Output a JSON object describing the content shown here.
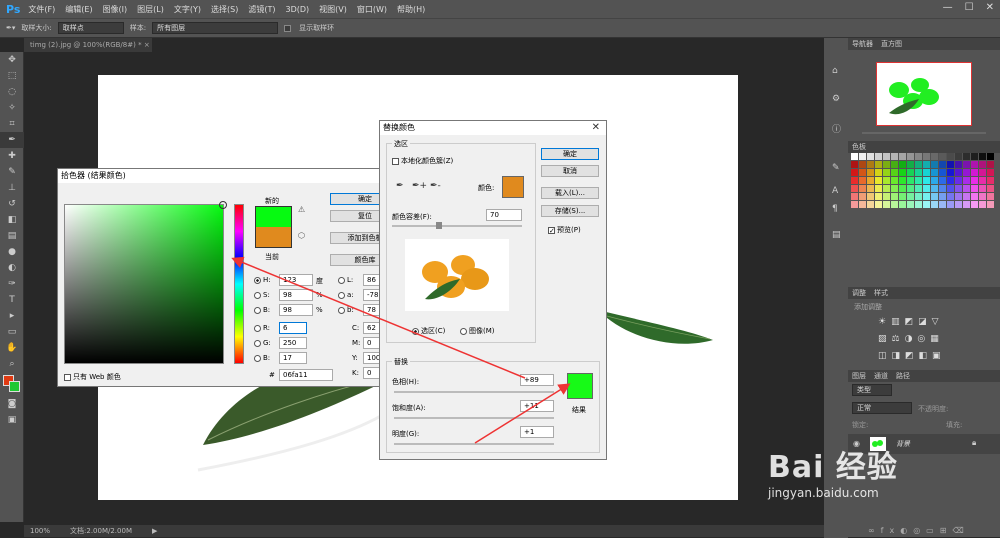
{
  "app": {
    "logo": "Ps"
  },
  "menu": [
    "文件(F)",
    "编辑(E)",
    "图像(I)",
    "图层(L)",
    "文字(Y)",
    "选择(S)",
    "滤镜(T)",
    "3D(D)",
    "视图(V)",
    "窗口(W)",
    "帮助(H)"
  ],
  "options": {
    "sample_size_label": "取样大小:",
    "sample_size_value": "取样点",
    "sample_label": "样本:",
    "sample_value": "所有图层",
    "show_ring": "显示取样环"
  },
  "document": {
    "tab_title": "timg (2).jpg @ 100%(RGB/8#) *",
    "zoom": "100%",
    "doc_info": "文档:2.00M/2.00M"
  },
  "colors": {
    "new": "#06fa11",
    "current": "#e08a1e",
    "fg": "#e03a12",
    "bg": "#1ec832",
    "result": "#17fa17",
    "orange_sample": "#e08a1e"
  },
  "picker": {
    "title": "拾色器 (结果颜色)",
    "new_label": "新的",
    "current_label": "当前",
    "ok": "确定",
    "reset": "复位",
    "add_swatch": "添加到色板",
    "color_lib": "颜色库",
    "H": "123",
    "H_unit": "度",
    "S": "98",
    "S_unit": "%",
    "Bv": "98",
    "B_unit": "%",
    "R": "6",
    "G": "250",
    "B": "17",
    "L": "86",
    "a": "-78",
    "b": "78",
    "C": "62",
    "M": "0",
    "Y": "100",
    "K": "0",
    "pct": "%",
    "hex": "06fa11",
    "hex_label": "#",
    "web_only": "只有 Web 颜色"
  },
  "replace": {
    "title": "替换颜色",
    "sel_group": "选区",
    "localized": "本地化颜色簇(Z)",
    "color_label": "颜色:",
    "fuzz_label": "颜色容差(F):",
    "fuzz": "70",
    "sel_radio": "选区(C)",
    "img_radio": "图像(M)",
    "ok": "确定",
    "cancel": "取消",
    "load": "载入(L)...",
    "save": "存储(S)...",
    "preview": "预览(P)",
    "rep_group": "替换",
    "hue_label": "色相(H):",
    "hue": "+89",
    "sat_label": "饱和度(A):",
    "sat": "+11",
    "light_label": "明度(G):",
    "light": "+1",
    "result_label": "结果"
  },
  "panels": {
    "nav_tabs": [
      "导航器",
      "直方图"
    ],
    "swatch_tabs": [
      "色板"
    ],
    "adj_tabs": [
      "调整",
      "样式"
    ],
    "adj_hint": "添加调整",
    "layer_tabs": [
      "图层",
      "通道",
      "路径"
    ],
    "kind": "类型",
    "blend": "正常",
    "opacity_label": "不透明度:",
    "lock_label": "锁定:",
    "fill_label": "填充:",
    "layer_name": "背景"
  },
  "watermark": {
    "brand": "Bai 经验",
    "url": "jingyan.baidu.com"
  }
}
